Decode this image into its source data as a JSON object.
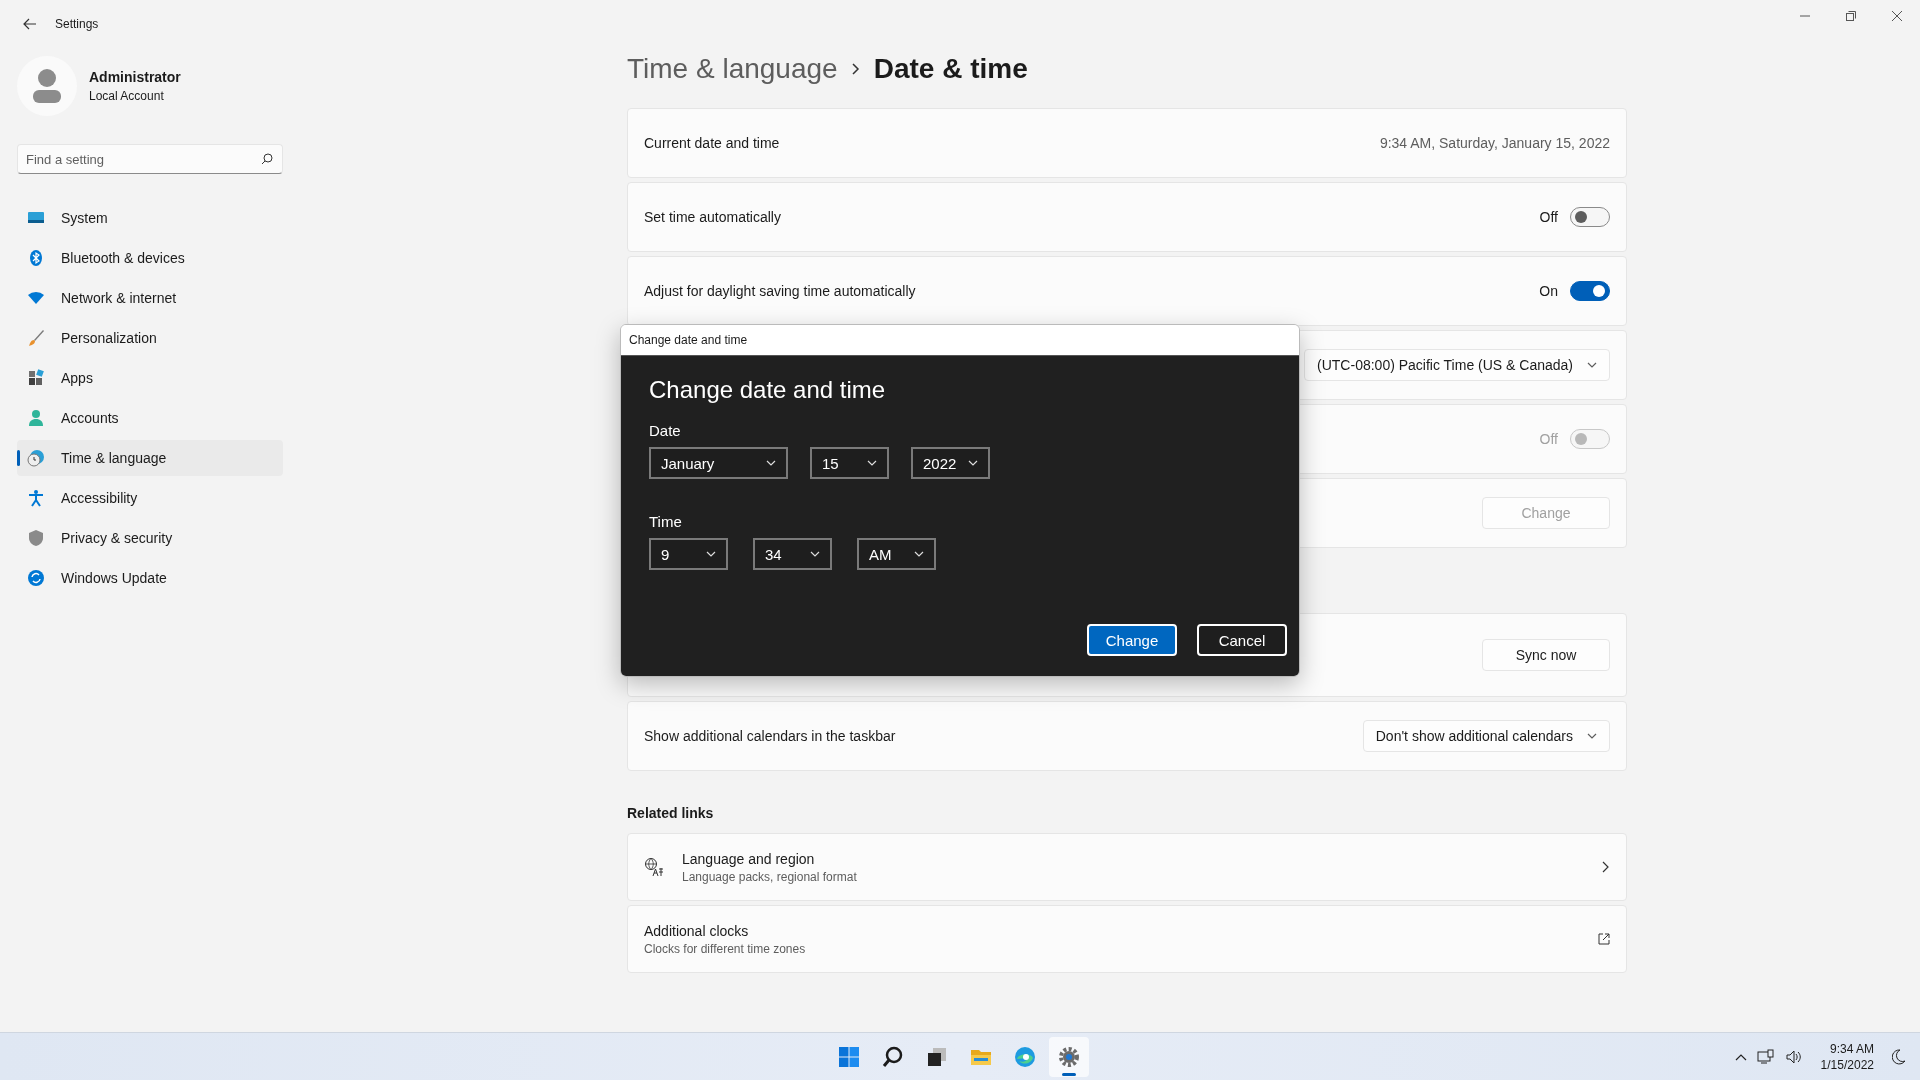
{
  "window": {
    "title": "Settings"
  },
  "account": {
    "name": "Administrator",
    "type": "Local Account"
  },
  "search": {
    "placeholder": "Find a setting"
  },
  "nav": [
    {
      "label": "System",
      "selected": false
    },
    {
      "label": "Bluetooth & devices",
      "selected": false
    },
    {
      "label": "Network & internet",
      "selected": false
    },
    {
      "label": "Personalization",
      "selected": false
    },
    {
      "label": "Apps",
      "selected": false
    },
    {
      "label": "Accounts",
      "selected": false
    },
    {
      "label": "Time & language",
      "selected": true
    },
    {
      "label": "Accessibility",
      "selected": false
    },
    {
      "label": "Privacy & security",
      "selected": false
    },
    {
      "label": "Windows Update",
      "selected": false
    }
  ],
  "breadcrumb": {
    "parent": "Time & language",
    "current": "Date & time"
  },
  "groups": [
    {
      "items": [
        {
          "kind": "value",
          "label": "Current date and time",
          "value": "9:34 AM, Saturday, January 15, 2022"
        },
        {
          "kind": "toggle",
          "label": "Set time automatically",
          "state_text": "Off",
          "on": false,
          "disabled": false
        },
        {
          "kind": "toggle",
          "label": "Adjust for daylight saving time automatically",
          "state_text": "On",
          "on": true,
          "disabled": false
        },
        {
          "kind": "dropdown",
          "value": "(UTC-08:00) Pacific Time (US & Canada)"
        },
        {
          "kind": "toggle",
          "state_text": "Off",
          "on": false,
          "disabled": true
        },
        {
          "kind": "button",
          "button": "Change",
          "disabled": true
        }
      ]
    },
    {
      "items": [
        {
          "kind": "sync",
          "button": "Sync now",
          "disabled": false
        },
        {
          "kind": "dropdown",
          "label": "Show additional calendars in the taskbar",
          "value": "Don't show additional calendars"
        }
      ]
    }
  ],
  "related": {
    "title": "Related links",
    "links": [
      {
        "kind": "chevron",
        "title": "Language and region",
        "subtitle": "Language packs, regional format"
      },
      {
        "kind": "external",
        "title": "Additional clocks",
        "subtitle": "Clocks for different time zones"
      }
    ]
  },
  "dialog": {
    "title_bar": "Change date and time",
    "heading": "Change date and time",
    "date_label": "Date",
    "date_fields": [
      "January",
      "15",
      "2022"
    ],
    "time_label": "Time",
    "time_fields": [
      "9",
      "34",
      "AM"
    ],
    "buttons": [
      {
        "label": "Change",
        "primary": true
      },
      {
        "label": "Cancel",
        "primary": false
      }
    ]
  },
  "taskbar": {
    "apps": [
      {
        "selected": false
      },
      {
        "selected": false
      },
      {
        "selected": false
      },
      {
        "selected": false
      },
      {
        "selected": false
      },
      {
        "selected": true
      }
    ],
    "time": "9:34 AM",
    "date": "1/15/2022"
  }
}
